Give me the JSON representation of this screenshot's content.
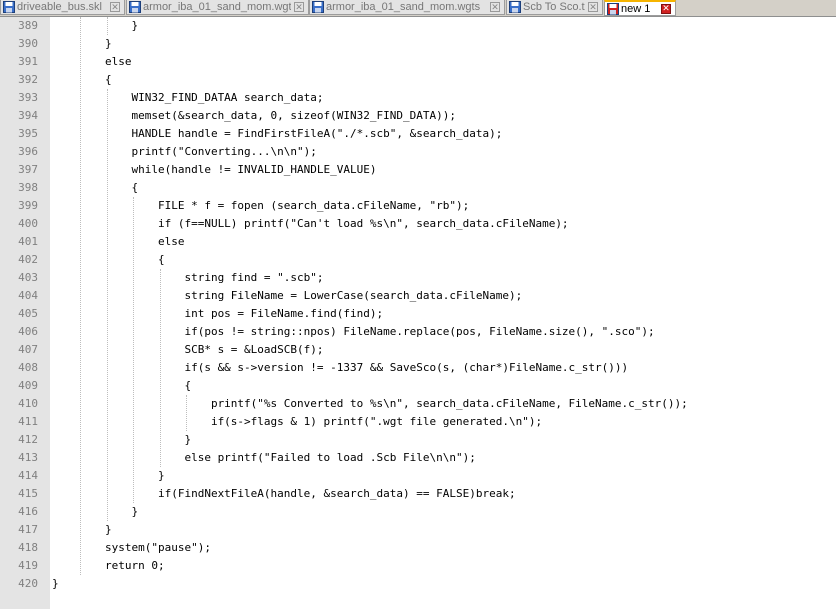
{
  "tabs": [
    {
      "label": "driveable_bus.skl",
      "active": false,
      "icon": "save-icon"
    },
    {
      "label": "armor_iba_01_sand_mom.wgt",
      "active": false,
      "icon": "save-icon"
    },
    {
      "label": "armor_iba_01_sand_mom.wgts",
      "active": false,
      "icon": "save-icon"
    },
    {
      "label": "Scb To Sco.txt",
      "active": false,
      "icon": "save-icon"
    },
    {
      "label": "new 1",
      "active": true,
      "icon": "save-icon-red"
    }
  ],
  "editor": {
    "lines": [
      {
        "n": "389",
        "text": "            }"
      },
      {
        "n": "390",
        "text": "        }"
      },
      {
        "n": "391",
        "text": "        else"
      },
      {
        "n": "392",
        "text": "        {"
      },
      {
        "n": "393",
        "text": "            WIN32_FIND_DATAA search_data;"
      },
      {
        "n": "394",
        "text": "            memset(&search_data, 0, sizeof(WIN32_FIND_DATA));"
      },
      {
        "n": "395",
        "text": "            HANDLE handle = FindFirstFileA(\"./*.scb\", &search_data);"
      },
      {
        "n": "396",
        "text": "            printf(\"Converting...\\n\\n\");"
      },
      {
        "n": "397",
        "text": "            while(handle != INVALID_HANDLE_VALUE)"
      },
      {
        "n": "398",
        "text": "            {"
      },
      {
        "n": "399",
        "text": "                FILE * f = fopen (search_data.cFileName, \"rb\");"
      },
      {
        "n": "400",
        "text": "                if (f==NULL) printf(\"Can't load %s\\n\", search_data.cFileName);"
      },
      {
        "n": "401",
        "text": "                else"
      },
      {
        "n": "402",
        "text": "                {"
      },
      {
        "n": "403",
        "text": "                    string find = \".scb\";"
      },
      {
        "n": "404",
        "text": "                    string FileName = LowerCase(search_data.cFileName);"
      },
      {
        "n": "405",
        "text": "                    int pos = FileName.find(find);"
      },
      {
        "n": "406",
        "text": "                    if(pos != string::npos) FileName.replace(pos, FileName.size(), \".sco\");"
      },
      {
        "n": "407",
        "text": "                    SCB* s = &LoadSCB(f);"
      },
      {
        "n": "408",
        "text": "                    if(s && s->version != -1337 && SaveSco(s, (char*)FileName.c_str()))"
      },
      {
        "n": "409",
        "text": "                    {"
      },
      {
        "n": "410",
        "text": "                        printf(\"%s Converted to %s\\n\", search_data.cFileName, FileName.c_str());"
      },
      {
        "n": "411",
        "text": "                        if(s->flags & 1) printf(\".wgt file generated.\\n\");"
      },
      {
        "n": "412",
        "text": "                    }"
      },
      {
        "n": "413",
        "text": "                    else printf(\"Failed to load .Scb File\\n\\n\");"
      },
      {
        "n": "414",
        "text": "                }"
      },
      {
        "n": "415",
        "text": "                if(FindNextFileA(handle, &search_data) == FALSE)break;"
      },
      {
        "n": "416",
        "text": "            }"
      },
      {
        "n": "417",
        "text": "        }"
      },
      {
        "n": "418",
        "text": "        system(\"pause\");"
      },
      {
        "n": "419",
        "text": "        return 0;"
      },
      {
        "n": "420",
        "text": "}"
      }
    ]
  }
}
